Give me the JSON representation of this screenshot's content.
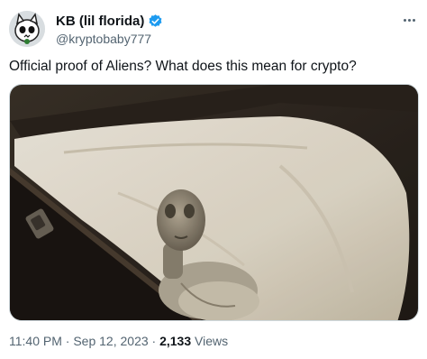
{
  "author": {
    "display_name": "KB (lil florida)",
    "handle": "@kryptobaby777",
    "verified": true,
    "avatar_icon": "skull-cat-avatar-icon"
  },
  "tweet": {
    "text": "Official proof of Aliens? What does this mean for crypto?"
  },
  "meta": {
    "time": "11:40 PM",
    "separator1": " · ",
    "date": "Sep 12, 2023",
    "separator2": " · ",
    "views_count": "2,133",
    "views_label": " Views"
  },
  "colors": {
    "verified_badge": "#1d9bf0",
    "secondary_text": "#536471",
    "primary_text": "#0f1419"
  }
}
